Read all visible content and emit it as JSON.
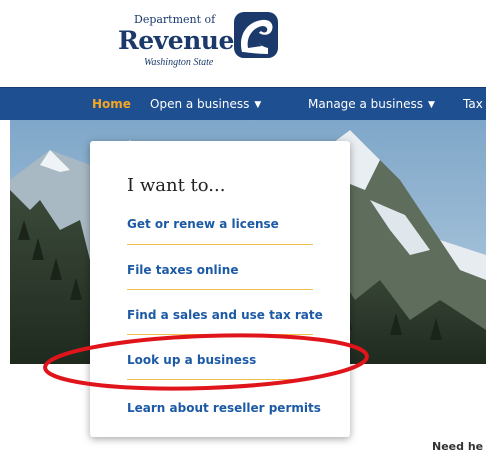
{
  "logo": {
    "department": "Department of",
    "name": "Revenue",
    "state": "Washington State",
    "colors": {
      "navy": "#1b3a6b"
    }
  },
  "nav": {
    "items": [
      {
        "label": "Home",
        "active": true
      },
      {
        "label": "Open a business",
        "has_caret": true
      },
      {
        "label": "Manage a business",
        "has_caret": true
      },
      {
        "label": "Tax"
      }
    ],
    "colors": {
      "bar": "#1d4f91",
      "active_text": "#f5a623",
      "text": "#ffffff"
    }
  },
  "dropdown": {
    "heading": "I want to...",
    "links": [
      {
        "label": "Get or renew a license"
      },
      {
        "label": "File taxes online"
      },
      {
        "label": "Find a sales and use tax rate"
      },
      {
        "label": "Look up a business",
        "highlighted": true
      },
      {
        "label": "Learn about reseller permits"
      }
    ],
    "colors": {
      "link": "#1d5aa6",
      "rule": "#f0c04d"
    }
  },
  "annotation": {
    "color": "#e0141b",
    "shape": "ellipse"
  },
  "footer_hint": {
    "text": "Need he"
  }
}
